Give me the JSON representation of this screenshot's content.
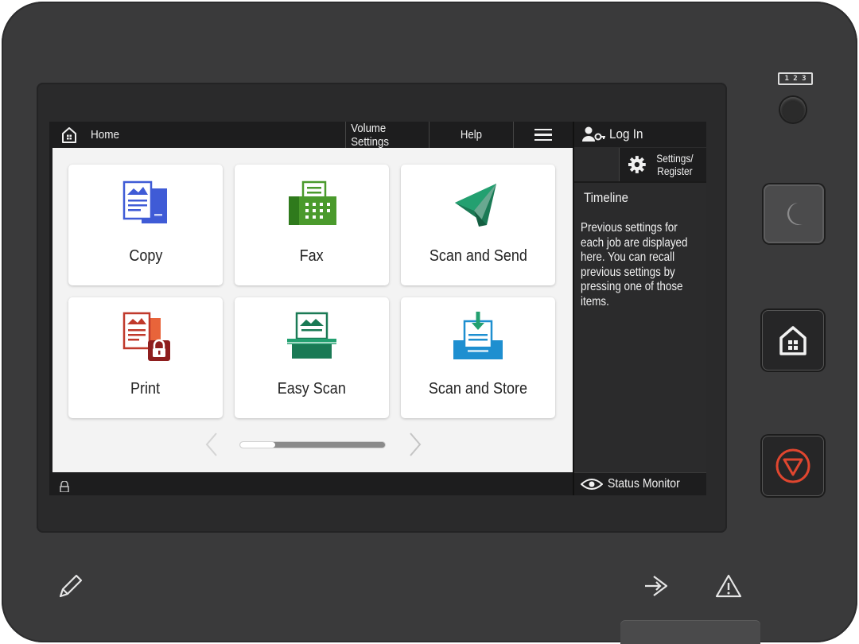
{
  "topbar": {
    "home_label": "Home",
    "volume_label": "Volume Settings",
    "help_label": "Help"
  },
  "tiles": [
    {
      "label": "Copy",
      "icon": "copy-icon"
    },
    {
      "label": "Fax",
      "icon": "fax-icon"
    },
    {
      "label": "Scan and Send",
      "icon": "scan-send-icon"
    },
    {
      "label": "Print",
      "icon": "print-icon"
    },
    {
      "label": "Easy Scan",
      "icon": "easy-scan-icon"
    },
    {
      "label": "Scan and Store",
      "icon": "scan-store-icon"
    }
  ],
  "pager": {
    "page": 1,
    "pages": 4
  },
  "side": {
    "login_label": "Log In",
    "settings_label": "Settings/\nRegister",
    "timeline_title": "Timeline",
    "timeline_text": "Previous settings for each job are displayed here. You can recall previous settings by pressing one of those items.",
    "status_label": "Status Monitor"
  },
  "hardware": {
    "counter_label": "1 2 3"
  },
  "colors": {
    "accent_blue": "#3f5bd6",
    "fax_green": "#4a9a2c",
    "scan_green": "#1a7a55",
    "print_red": "#c0392b",
    "store_blue": "#1e8fd0",
    "stop_red": "#e0462f"
  }
}
